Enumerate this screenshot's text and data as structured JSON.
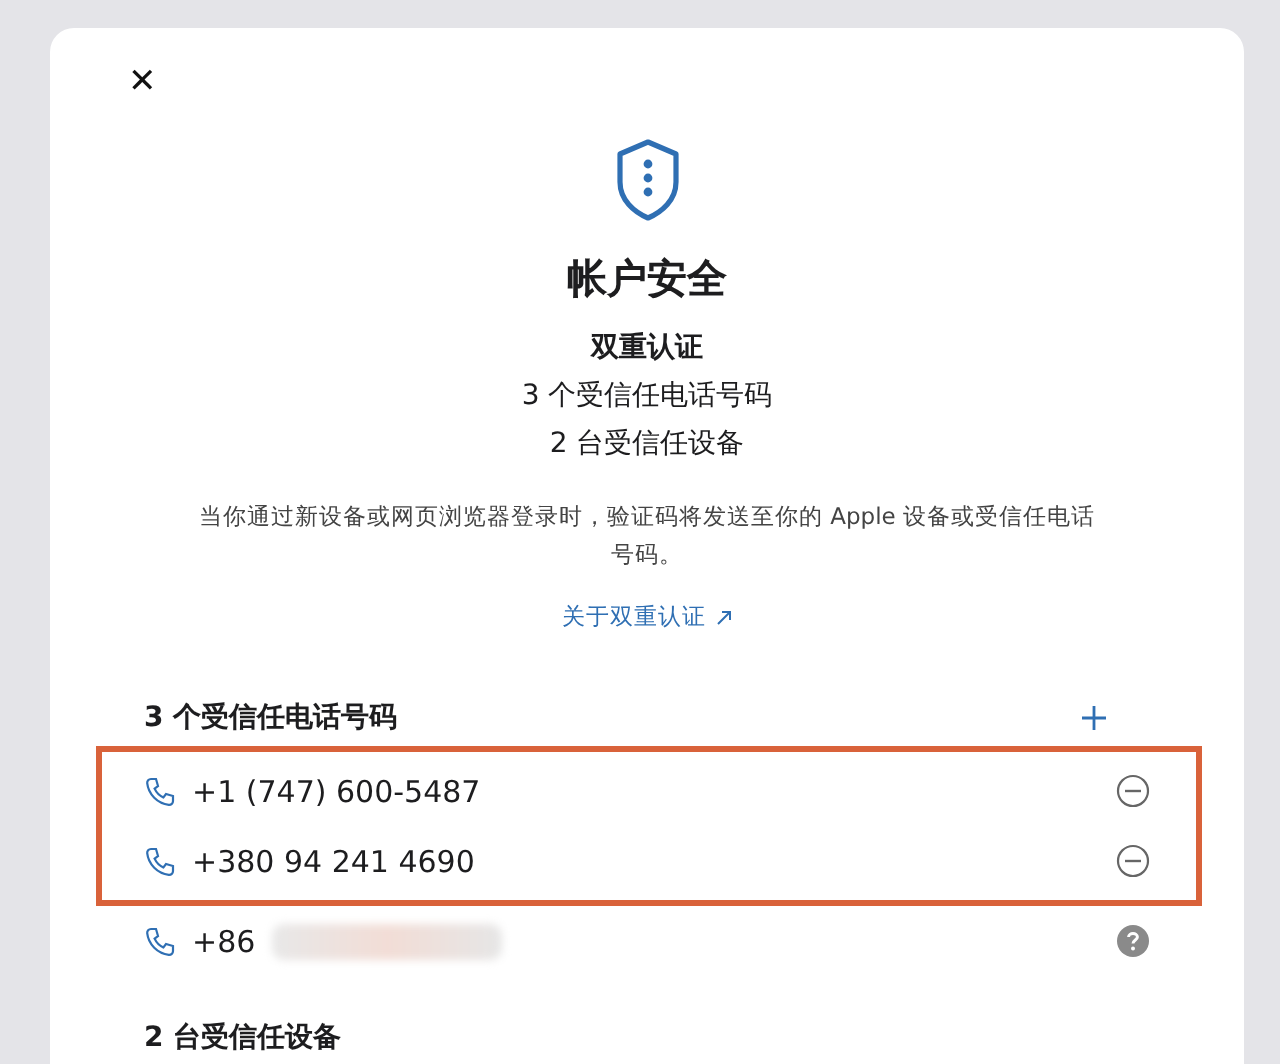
{
  "dialog": {
    "close_label": "✕",
    "title": "帐户安全",
    "subtitle": "双重认证",
    "summary": [
      "3 个受信任电话号码",
      "2 台受信任设备"
    ],
    "description": "当你通过新设备或网页浏览器登录时，验证码将发送至你的 Apple 设备或受信任电话号码。",
    "link": "关于双重认证"
  },
  "phone_section": {
    "heading": "3 个受信任电话号码",
    "phones": [
      {
        "number": "+1 (747) 600-5487",
        "kind": "remove",
        "highlighted": true,
        "redacted": false
      },
      {
        "number": "+380 94 241 4690",
        "kind": "remove",
        "highlighted": true,
        "redacted": false
      },
      {
        "number": "+86",
        "kind": "help",
        "highlighted": false,
        "redacted": true
      }
    ]
  },
  "device_section": {
    "heading": "2 台受信任设备"
  }
}
